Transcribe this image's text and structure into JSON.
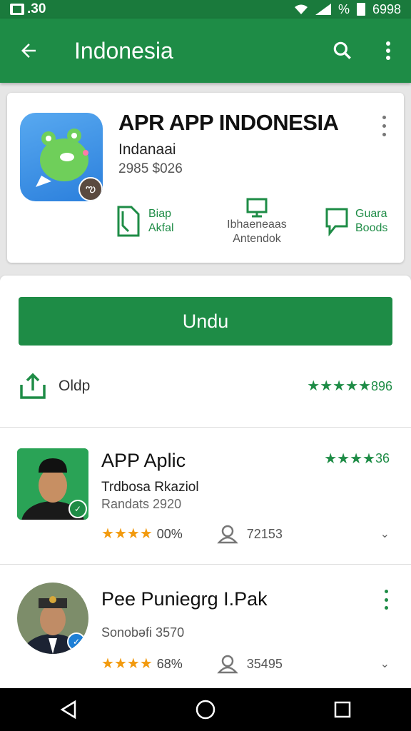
{
  "status": {
    "time": ".30",
    "battery_pct": "%",
    "right_text": "6998"
  },
  "appbar": {
    "title": "Indonesia",
    "back_icon": "arrow-back-icon",
    "search_icon": "search-icon",
    "more_icon": "more-vert-icon"
  },
  "app": {
    "name": "APR APP INDONESIA",
    "developer": "Indanaai",
    "meta": "2985 $026",
    "actions": [
      {
        "line1": "Biap",
        "line2": "Akfal",
        "icon": "document-icon"
      },
      {
        "line1": "Ibhaeneaas",
        "line2": "Antendok",
        "icon": "screen-icon"
      },
      {
        "line1": "Guara",
        "line2": "Boods",
        "icon": "chat-icon"
      }
    ]
  },
  "install": {
    "label": "Undu"
  },
  "secondary": {
    "label": "Oldp",
    "rating_value": "896",
    "stars": 4.5
  },
  "list": [
    {
      "name": "APP Aplic",
      "subtitle": "Trdbosa Rkaziol",
      "subtitle2": "Randats 2920",
      "stars": 4,
      "pct": "00%",
      "users": "72153",
      "top_rating": "36",
      "top_stars": 4
    },
    {
      "name": "Pee Puniegrg I.Pak",
      "subtitle2": "Sonobəfi 3570",
      "stars": 4,
      "pct": "68%",
      "users": "35495"
    }
  ],
  "colors": {
    "primary": "#1e8c46",
    "statusbar": "#1a7a3c",
    "star": "#f29a0e"
  }
}
